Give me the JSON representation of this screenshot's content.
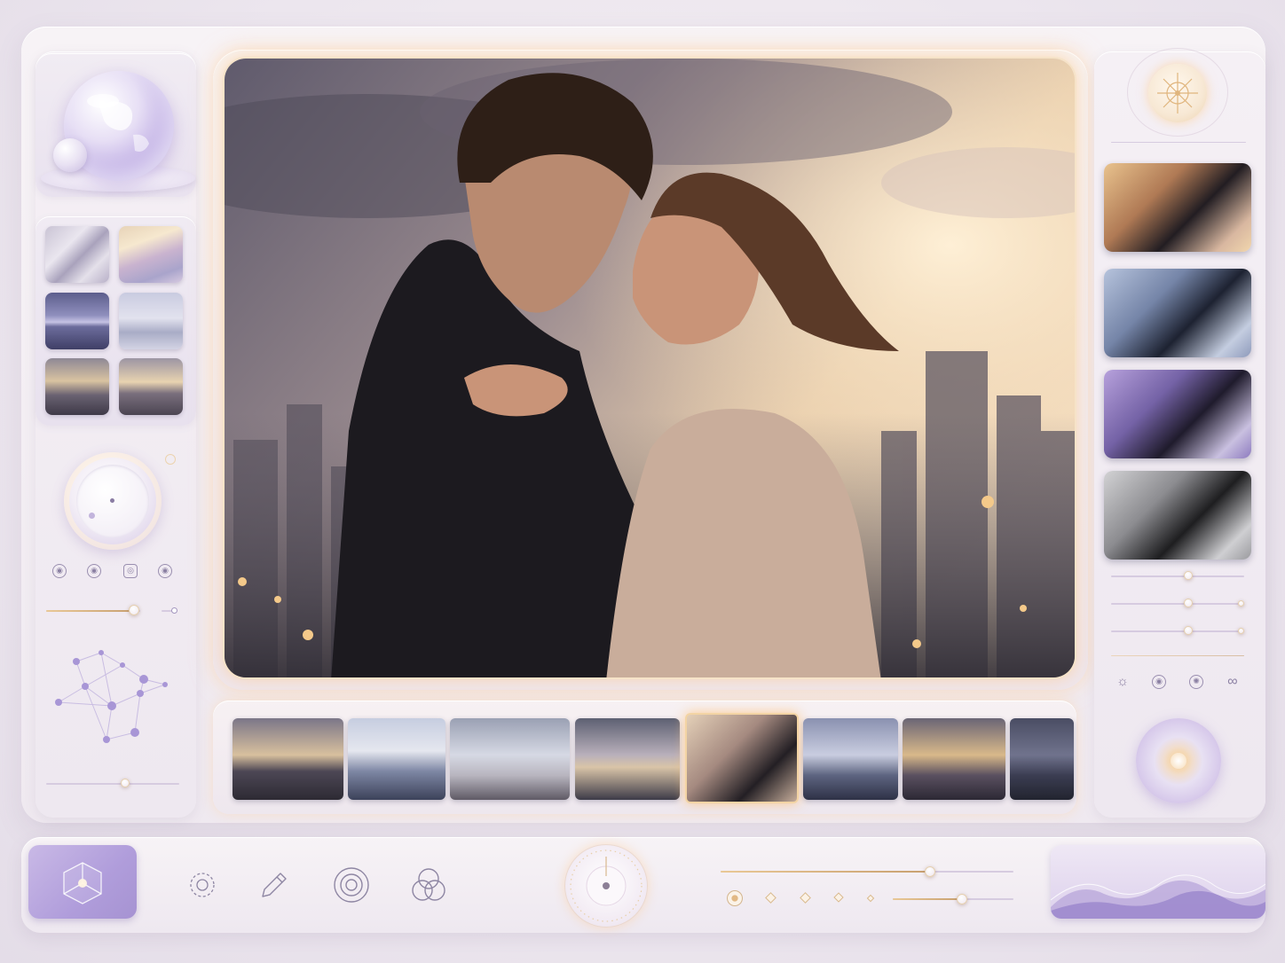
{
  "colors": {
    "accent_gold": "#e9c896",
    "accent_lavender": "#b09ddb",
    "panel": "#f5f0f5"
  },
  "left_panel": {
    "orb": "crystal-globe",
    "swatches": [
      "silver-waves",
      "golden-waves",
      "violet-horizon",
      "misty-city",
      "sunset-street",
      "golden-boulevard"
    ],
    "icons": [
      "eye-icon",
      "target-icon",
      "frame-icon",
      "eye-icon"
    ]
  },
  "right_panel": {
    "variants": [
      "warm-golden",
      "cool-blue",
      "violet-night",
      "monochrome"
    ],
    "slider_levels": [
      0.6,
      0.6,
      0.6
    ],
    "icons": [
      "sun-icon",
      "target-icon",
      "spark-icon",
      "infinity-icon"
    ]
  },
  "filmstrip": {
    "frames": [
      "sunset-skyline",
      "harbor-figure",
      "penthouse-interior",
      "tower-dusk",
      "embrace",
      "city-towers",
      "golden-spires",
      "night-boulevard"
    ],
    "active_index": 4
  },
  "toolbar": {
    "tools": [
      "settings-icon",
      "pen-icon",
      "rings-icon",
      "overlap-icon"
    ],
    "slider_levels": [
      0.7,
      0.6
    ]
  }
}
